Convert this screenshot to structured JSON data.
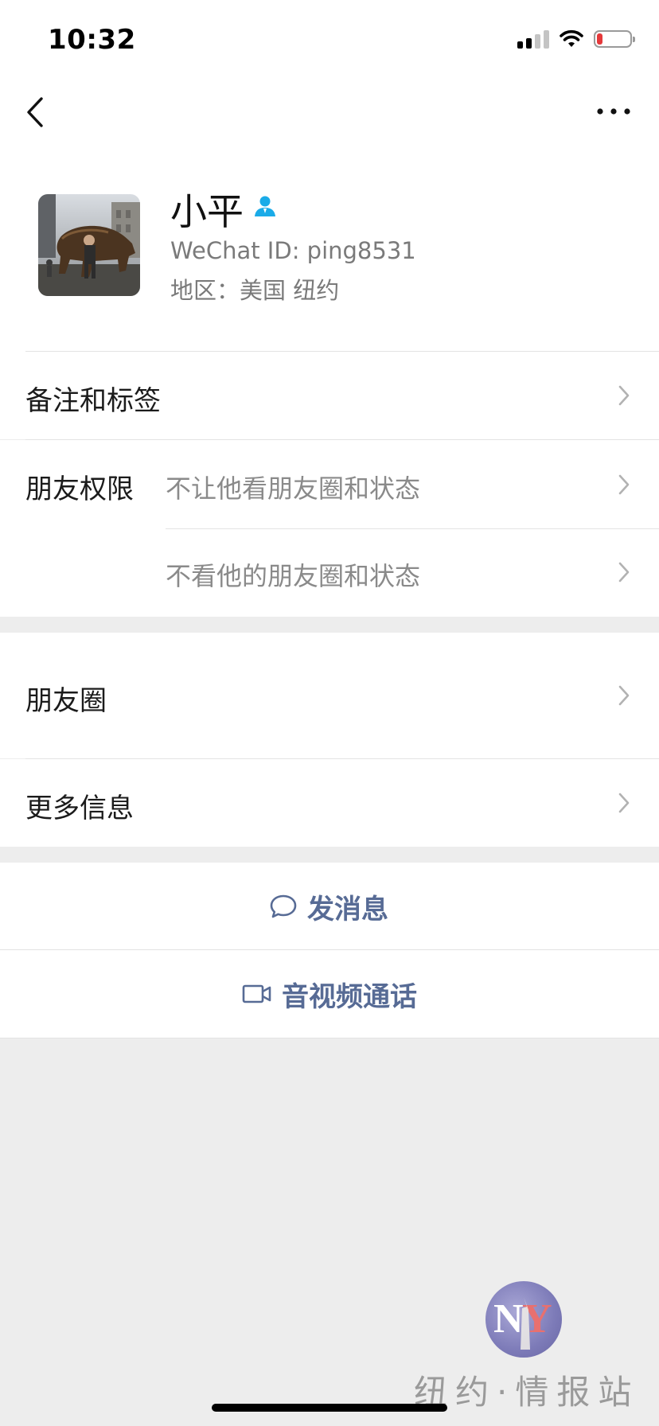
{
  "status_bar": {
    "time": "10:32",
    "battery_color": "#e5393b"
  },
  "nav": {
    "back_icon": "chevron-left-icon",
    "more_icon": "more-horizontal-icon"
  },
  "profile": {
    "name": "小平",
    "wechat_id": "WeChat ID: ping8531",
    "region": "地区：美国 纽约",
    "badge_icon": "user-badge-icon",
    "badge_color": "#1aabe8"
  },
  "rows": {
    "remarks_label": "备注和标签",
    "permissions_label": "朋友权限",
    "permission_option_1": "不让他看朋友圈和状态",
    "permission_option_2": "不看他的朋友圈和状态",
    "moments_label": "朋友圈",
    "more_info_label": "更多信息"
  },
  "actions": {
    "message_label": "发消息",
    "message_icon": "chat-bubble-icon",
    "call_label": "音视频通话",
    "call_icon": "video-camera-icon",
    "accent_color": "#576b95"
  },
  "watermark": {
    "logo_text": "NY",
    "text": "纽约·情报站"
  }
}
